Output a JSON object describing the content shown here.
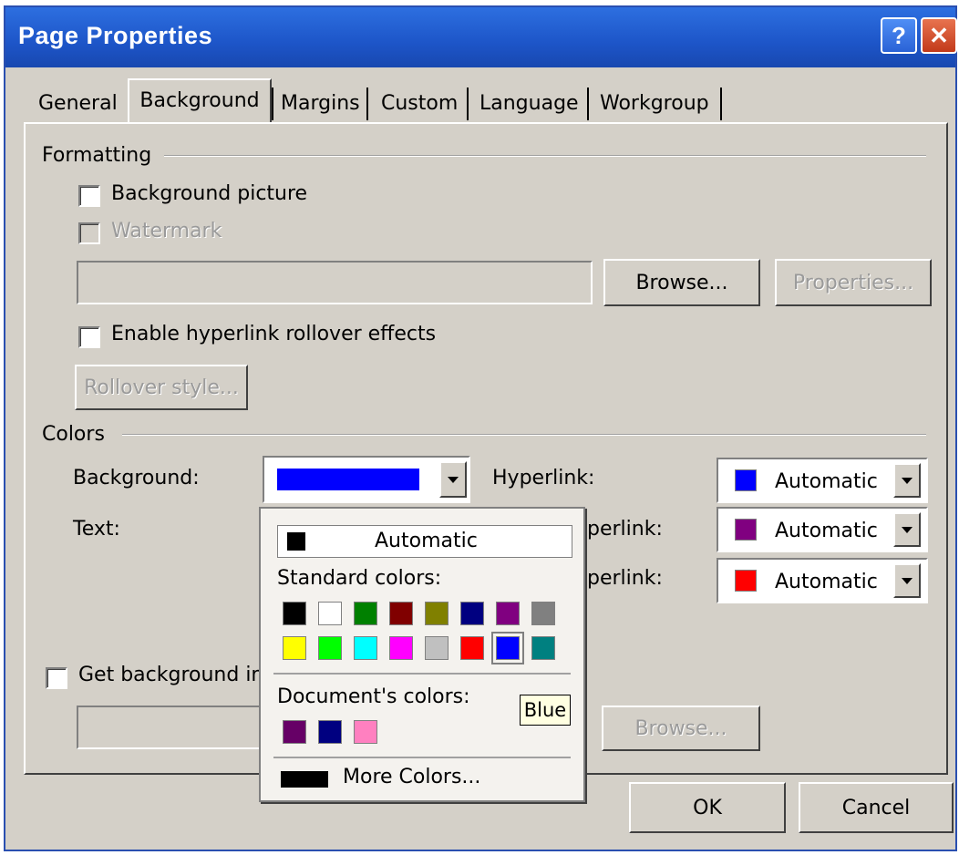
{
  "window": {
    "title": "Page Properties",
    "help_label": "?",
    "close_label": "✕"
  },
  "tabs": [
    {
      "label": "General",
      "active": false
    },
    {
      "label": "Background",
      "active": true
    },
    {
      "label": "Margins",
      "active": false
    },
    {
      "label": "Custom",
      "active": false
    },
    {
      "label": "Language",
      "active": false
    },
    {
      "label": "Workgroup",
      "active": false
    }
  ],
  "formatting": {
    "heading": "Formatting",
    "background_picture": {
      "label": "Background picture",
      "checked": false
    },
    "watermark": {
      "label": "Watermark",
      "checked": false,
      "disabled": true
    },
    "picture_path": "",
    "browse_label": "Browse...",
    "properties_label": "Properties...",
    "rollover": {
      "label": "Enable hyperlink rollover effects",
      "checked": false
    },
    "rollover_style_label": "Rollover style..."
  },
  "colors": {
    "heading": "Colors",
    "background_label": "Background:",
    "background_color": "#0000ff",
    "text_label": "Text:",
    "hyperlink_label": "Hyperlink:",
    "visited_label_partial": "perlink:",
    "active_label_partial": "perlink:",
    "hyperlink": {
      "text": "Automatic",
      "color": "#0000ff"
    },
    "visited": {
      "text": "Automatic",
      "color": "#800080"
    },
    "active": {
      "text": "Automatic",
      "color": "#ff0000"
    }
  },
  "get_background": {
    "label_partial": "Get background in",
    "checked": false,
    "path": "",
    "browse_label": "Browse..."
  },
  "color_popup": {
    "automatic_label": "Automatic",
    "automatic_color": "#000000",
    "standard_label": "Standard colors:",
    "standard_colors": [
      "#000000",
      "#ffffff",
      "#008000",
      "#800000",
      "#808000",
      "#000080",
      "#800080",
      "#808080",
      "#ffff00",
      "#00ff00",
      "#00ffff",
      "#ff00ff",
      "#c0c0c0",
      "#ff0000",
      "#0000ff",
      "#008080"
    ],
    "selected_index": 14,
    "document_label": "Document's colors:",
    "document_colors": [
      "#660066",
      "#000080",
      "#ff80c0"
    ],
    "more_colors_label": "More Colors...",
    "more_colors_swatch": "#000000",
    "tooltip": "Blue"
  },
  "footer": {
    "ok_label": "OK",
    "cancel_label": "Cancel"
  }
}
